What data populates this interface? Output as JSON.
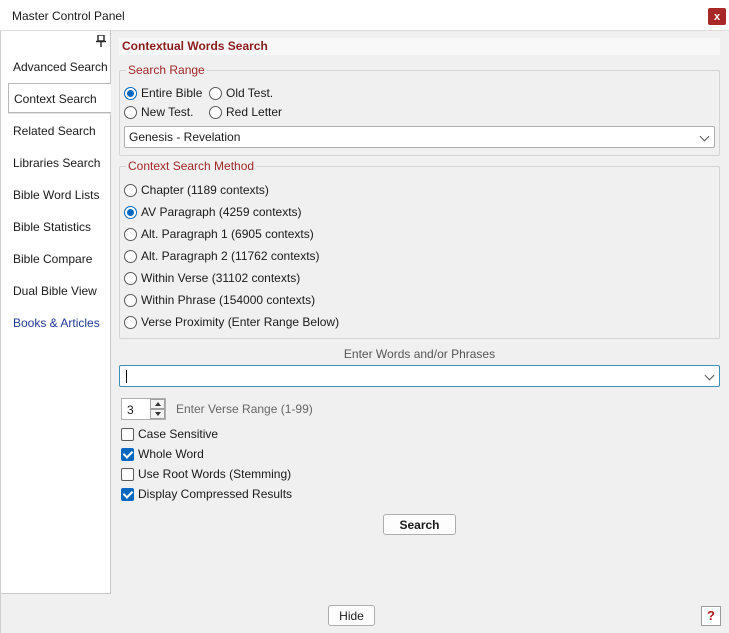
{
  "window": {
    "title": "Master Control Panel",
    "close_label": "x"
  },
  "sidebar": {
    "items": [
      {
        "label": "Advanced Search"
      },
      {
        "label": "Context Search"
      },
      {
        "label": "Related Search"
      },
      {
        "label": "Libraries Search"
      },
      {
        "label": "Bible Word Lists"
      },
      {
        "label": "Bible Statistics"
      },
      {
        "label": "Bible Compare"
      },
      {
        "label": "Dual Bible View"
      },
      {
        "label": "Books & Articles"
      }
    ],
    "active_item": "Context Search"
  },
  "main": {
    "title": "Contextual Words Search",
    "search_range": {
      "legend": "Search Range",
      "options": [
        "Entire Bible",
        "Old Test.",
        "New Test.",
        "Red Letter"
      ],
      "selected": "Entire Bible",
      "range_value": "Genesis - Revelation"
    },
    "method": {
      "legend": "Context Search Method",
      "options": [
        "Chapter (1189 contexts)",
        "AV Paragraph (4259 contexts)",
        "Alt. Paragraph 1 (6905 contexts)",
        "Alt. Paragraph 2 (11762 contexts)",
        "Within Verse (31102 contexts)",
        "Within Phrase (154000 contexts)",
        "Verse Proximity (Enter Range Below)"
      ],
      "selected": "AV Paragraph (4259 contexts)"
    },
    "words": {
      "label": "Enter Words and/or Phrases",
      "value": ""
    },
    "verse_range": {
      "value": "3",
      "label": "Enter Verse Range (1-99)"
    },
    "options": [
      {
        "label": "Case Sensitive",
        "checked": false
      },
      {
        "label": "Whole Word",
        "checked": true
      },
      {
        "label": "Use Root Words (Stemming)",
        "checked": false
      },
      {
        "label": "Display Compressed Results",
        "checked": true
      }
    ],
    "search_button": "Search"
  },
  "footer": {
    "hide_button": "Hide",
    "help_label": "?"
  },
  "colors": {
    "accent": "#0067c0",
    "title_red": "#8b1c1c",
    "legend_red": "#a02828",
    "close_red": "#a82828",
    "link_blue": "#1f3a93"
  }
}
